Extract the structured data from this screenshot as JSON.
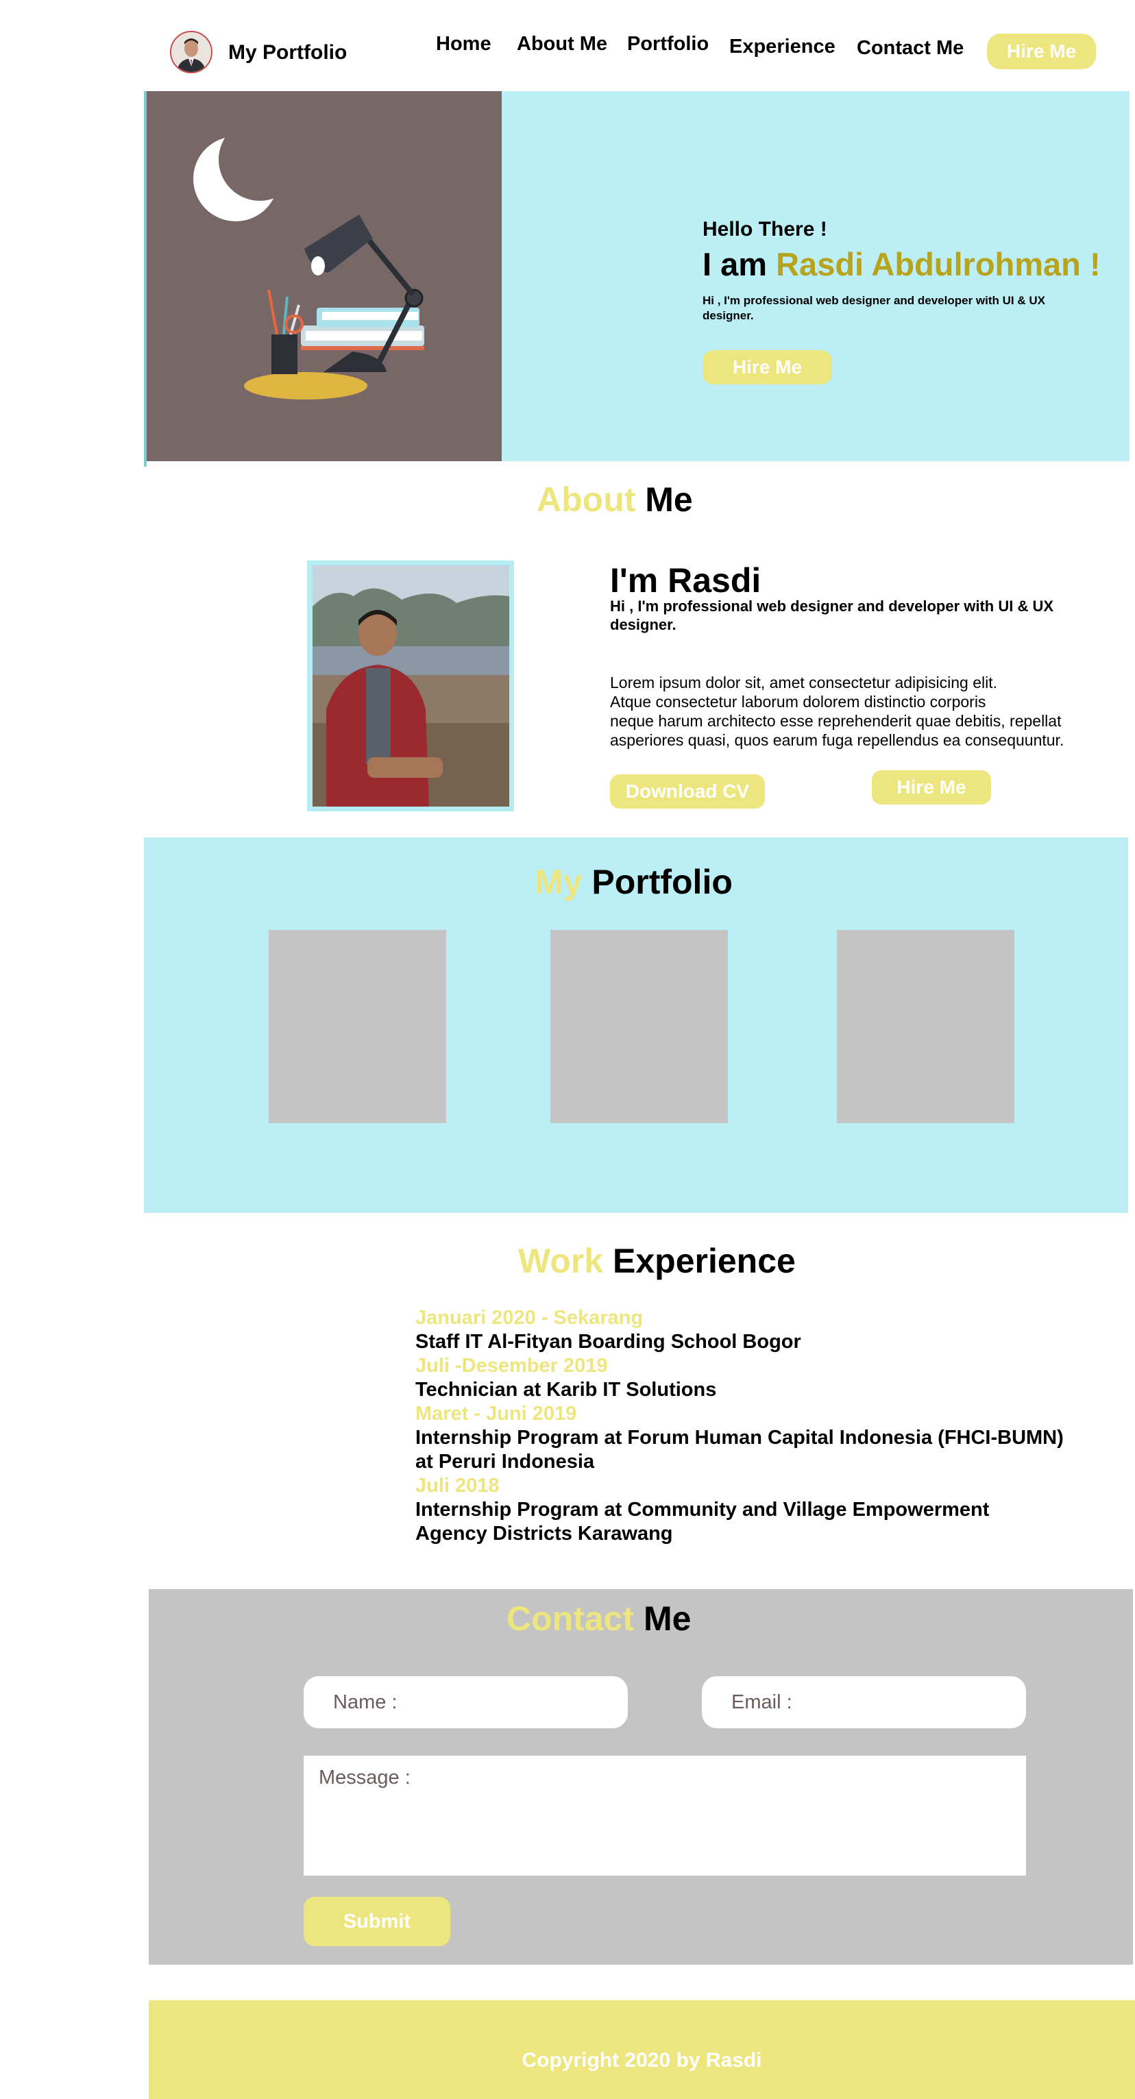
{
  "navbar": {
    "brand": "My Portfolio",
    "links": [
      "Home",
      "About Me",
      "Portfolio",
      "Experience",
      "Contact Me"
    ],
    "cta": "Hire Me"
  },
  "hero": {
    "greeting": "Hello There !",
    "intro_prefix": "I am ",
    "name": "Rasdi Abdulrohman !",
    "description": "Hi , I'm professional web designer and developer with UI & UX designer.",
    "cta": "Hire Me"
  },
  "about": {
    "title_highlight": "About",
    "title_rest": " Me",
    "heading": "I'm Rasdi",
    "subheading": "Hi , I'm professional web designer and developer with UI & UX designer.",
    "body": "Lorem ipsum dolor sit, amet consectetur adipisicing elit.\nAtque consectetur laborum dolorem distinctio corporis\nneque harum architecto esse reprehenderit quae debitis, repellat\n asperiores quasi, quos earum fuga repellendus ea consequuntur.",
    "download_cv": "Download CV",
    "hire": "Hire Me"
  },
  "portfolio": {
    "title_highlight": "My",
    "title_rest": " Portfolio"
  },
  "experience": {
    "title_highlight": "Work",
    "title_rest": " Experience",
    "items": [
      {
        "period": "Januari 2020 - Sekarang",
        "role": "Staff IT Al-Fityan Boarding School Bogor"
      },
      {
        "period": "Juli -Desember 2019",
        "role": "Technician  at Karib IT Solutions"
      },
      {
        "period": "Maret - Juni 2019",
        "role": "Internship Program at Forum Human Capital Indonesia (FHCI-BUMN) at Peruri Indonesia"
      },
      {
        "period": "Juli 2018",
        "role": "Internship Program at Community and Village Empowerment Agency Districts Karawang"
      }
    ]
  },
  "contact": {
    "title_highlight": "Contact",
    "title_rest": " Me",
    "name_placeholder": "Name :",
    "email_placeholder": "Email :",
    "message_placeholder": "Message :",
    "submit": "Submit"
  },
  "footer": {
    "copyright": "Copyright 2020 by Rasdi"
  },
  "colors": {
    "accent_yellow": "#ede67f",
    "hero_name": "#b8a41c",
    "light_blue": "#bbeef5",
    "gray": "#c4c4c4"
  }
}
